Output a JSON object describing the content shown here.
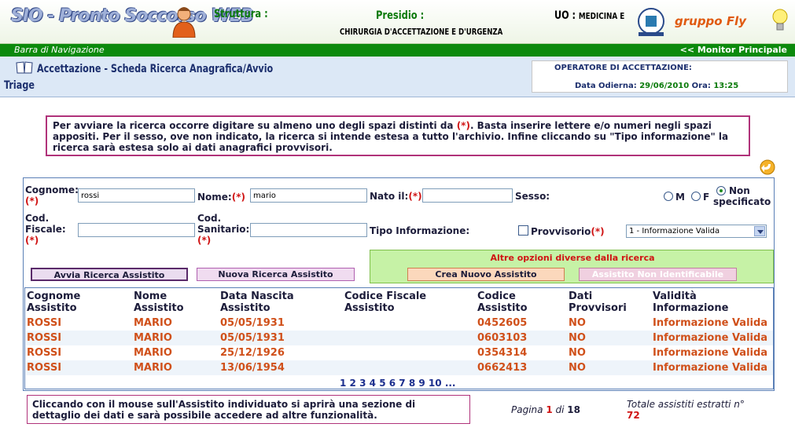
{
  "header": {
    "logo": "SIO - Pronto Soccorso WEB",
    "struttura_label": "Struttura :",
    "presidio_label": "Presidio :",
    "presidio_value": "CHIRURGIA D'ACCETTAZIONE E D'URGENZA",
    "uo_label": "UO :",
    "uo_value": "MEDICINA E",
    "brand": "gruppo Fly"
  },
  "navbar": {
    "left": "Barra di Navigazione",
    "right": "<< Monitor Principale"
  },
  "titlebar": {
    "title": "Accettazione - Scheda Ricerca Anagrafica/Avvio",
    "subtitle": "Triage",
    "operator_label": "OPERATORE DI ACCETTAZIONE:",
    "date_label": "Data Odierna:",
    "date_value": "29/06/2010",
    "time_label": "Ora:",
    "time_value": "13:25"
  },
  "notice": {
    "part1": "Per avviare la ricerca occorre digitare su almeno uno degli spazi distinti da ",
    "marker": "(*)",
    "part2": ". Basta inserire lettere e/o numeri negli spazi appositi. Per il sesso, ove non indicato, la ricerca si intende estesa a tutto l'archivio. Infine cliccando su \"Tipo informazione\" la ricerca sarà estesa solo ai dati anagrafici provvisori."
  },
  "form": {
    "required_marker": "(*)",
    "cognome_label": "Cognome:",
    "cognome_value": "rossi",
    "nome_label": "Nome:",
    "nome_value": "mario",
    "nato_label": "Nato il:",
    "nato_value": "",
    "sesso_label": "Sesso:",
    "sesso_m": "M",
    "sesso_f": "F",
    "sesso_ns": "Non specificato",
    "codfisc_label1": "Cod.",
    "codfisc_label2": "Fiscale:",
    "codsan_label1": "Cod.",
    "codsan_label2": "Sanitario:",
    "tipo_label": "Tipo Informazione:",
    "provvisorio_label": "Provvisorio",
    "tipo_select": "1 - Informazione Valida"
  },
  "buttons": {
    "avvia": "Avvia Ricerca Assistito",
    "nuova": "Nuova Ricerca Assistito",
    "altre_opzioni": "Altre opzioni diverse dalla ricerca",
    "crea": "Crea Nuovo Assistito",
    "non_identificabile": "Assistito Non Identificabile"
  },
  "table": {
    "headers": [
      [
        "Cognome",
        "Assistito"
      ],
      [
        "Nome",
        "Assistito"
      ],
      [
        "Data Nascita",
        "Assistito"
      ],
      [
        "Codice Fiscale",
        "Assistito"
      ],
      [
        "Codice",
        "Assistito"
      ],
      [
        "Dati",
        "Provvisori"
      ],
      [
        "Validità",
        "Informazione"
      ]
    ],
    "rows": [
      [
        "ROSSI",
        "MARIO",
        "05/05/1931",
        "",
        "0452605",
        "NO",
        "Informazione Valida"
      ],
      [
        "ROSSI",
        "MARIO",
        "05/05/1931",
        "",
        "0603103",
        "NO",
        "Informazione Valida"
      ],
      [
        "ROSSI",
        "MARIO",
        "25/12/1926",
        "",
        "0354314",
        "NO",
        "Informazione Valida"
      ],
      [
        "ROSSI",
        "MARIO",
        "13/06/1954",
        "",
        "0662413",
        "NO",
        "Informazione Valida"
      ]
    ],
    "pagination": [
      "1",
      "2",
      "3",
      "4",
      "5",
      "6",
      "7",
      "8",
      "9",
      "10",
      "..."
    ]
  },
  "footer": {
    "note": "Cliccando con il mouse sull'Assistito individuato si aprirà una sezione di dettaglio dei dati e sarà possibile accedere ad altre funzionalità.",
    "pagina_label": "Pagina",
    "pagina_current": "1",
    "pagina_of": "di",
    "pagina_total": "18",
    "totale_label": "Totale assistiti estratti n°",
    "totale_value": "72"
  },
  "colors": {
    "nav_green": "#0c8a0c",
    "title_blue": "#dce8f6",
    "result_orange": "#d0501a",
    "required_red": "#d01414"
  }
}
